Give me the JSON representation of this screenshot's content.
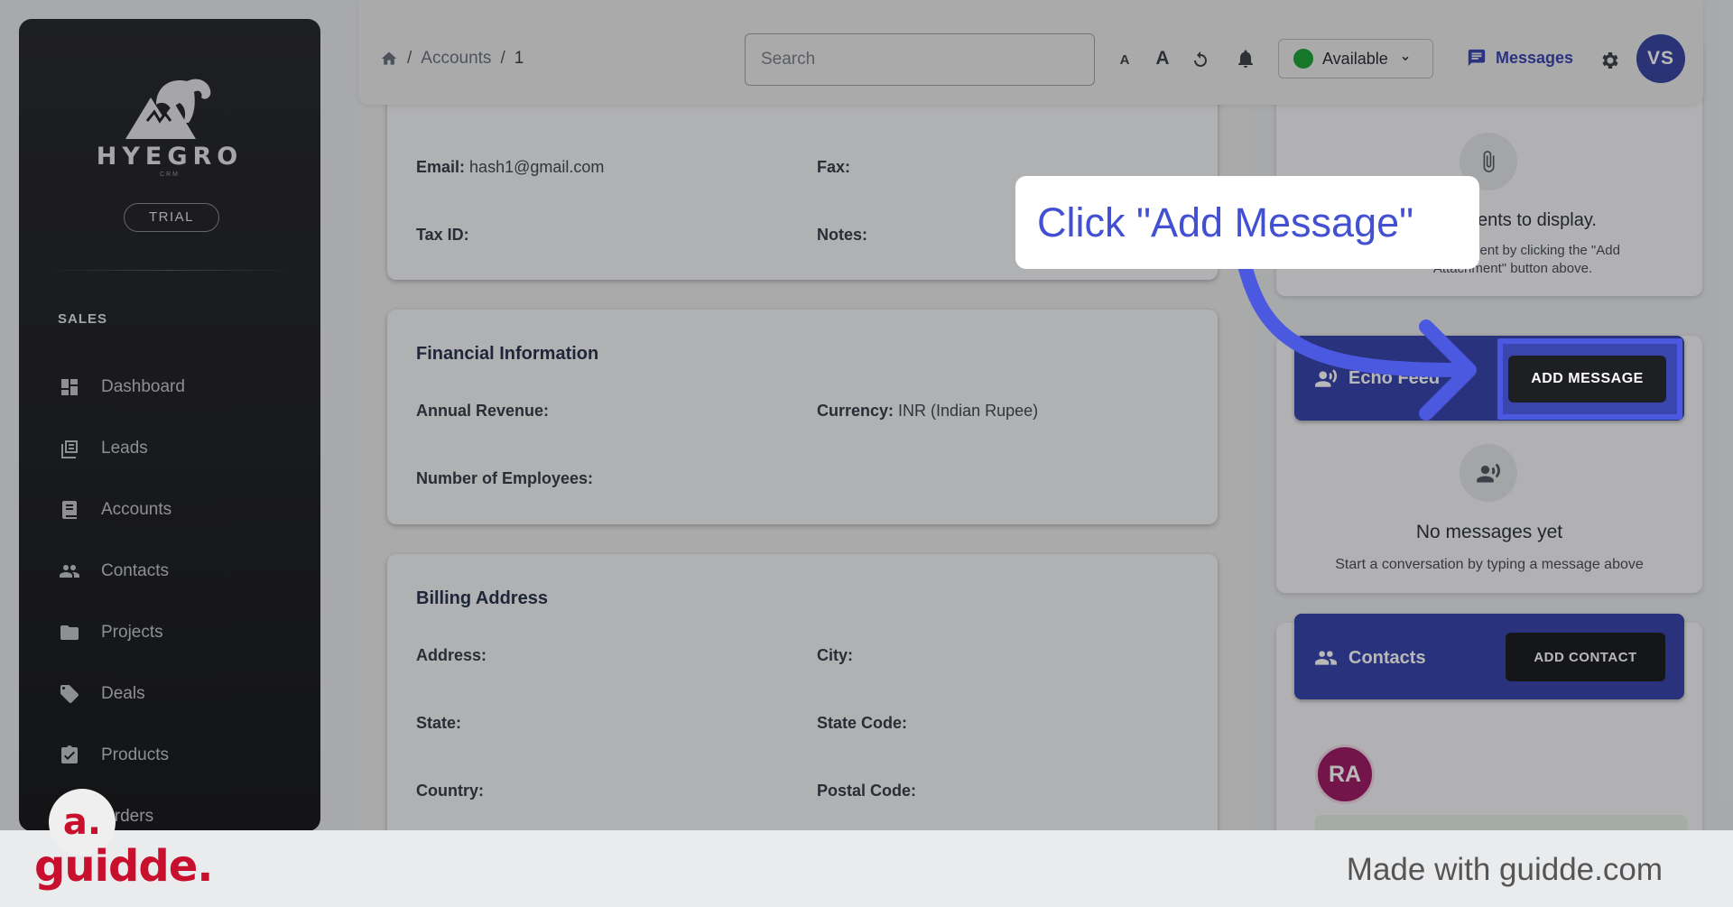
{
  "sidebar": {
    "brand": "HYEGRO",
    "brand_sub": "CRM",
    "plan_badge": "TRIAL",
    "section": "SALES",
    "items": [
      {
        "label": "Dashboard",
        "icon": "dashboard-icon"
      },
      {
        "label": "Leads",
        "icon": "leads-icon"
      },
      {
        "label": "Accounts",
        "icon": "accounts-icon"
      },
      {
        "label": "Contacts",
        "icon": "contacts-icon"
      },
      {
        "label": "Projects",
        "icon": "folder-icon"
      },
      {
        "label": "Deals",
        "icon": "tag-icon"
      },
      {
        "label": "Products",
        "icon": "clipboard-icon"
      },
      {
        "label": "Orders",
        "icon": "cart-icon"
      }
    ]
  },
  "topbar": {
    "breadcrumb": [
      "Accounts",
      "1"
    ],
    "search_placeholder": "Search",
    "font_small": "A",
    "font_large": "A",
    "status": "Available",
    "messages": "Messages",
    "user_initials": "VS"
  },
  "account": {
    "email_label": "Email:",
    "email_value": "hash1@gmail.com",
    "fax_label": "Fax:",
    "taxid_label": "Tax ID:",
    "notes_label": "Notes:"
  },
  "financial": {
    "title": "Financial Information",
    "annual_revenue_label": "Annual Revenue:",
    "currency_label": "Currency:",
    "currency_value": "INR (Indian Rupee)",
    "employees_label": "Number of Employees:"
  },
  "billing": {
    "title": "Billing Address",
    "address_label": "Address:",
    "city_label": "City:",
    "state_label": "State:",
    "state_code_label": "State Code:",
    "country_label": "Country:",
    "postal_label": "Postal Code:"
  },
  "attachments": {
    "empty_title": "ents to display.",
    "empty_hint_1": "ment by clicking the \"Add",
    "empty_hint_2": "Attachment\" button above."
  },
  "echo_feed": {
    "title": "Echo Feed",
    "add_button": "ADD MESSAGE",
    "empty_title": "No messages yet",
    "empty_hint": "Start a conversation by typing a message above"
  },
  "contacts_panel": {
    "title": "Contacts",
    "add_button": "ADD CONTACT",
    "avatar_initials": "RA"
  },
  "guide": {
    "callout": "Click \"Add Message\"",
    "accent": "#4250d1"
  },
  "footer": {
    "brand": "guidde.",
    "bubble": "a.",
    "made_with": "Made with guidde.com"
  }
}
